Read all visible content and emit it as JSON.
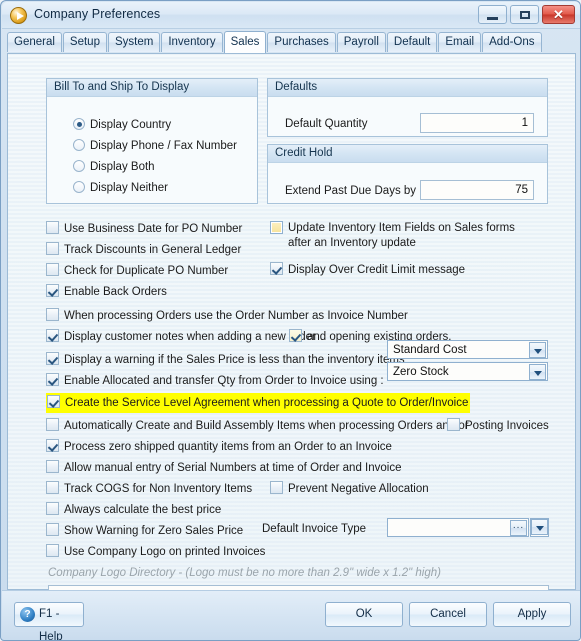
{
  "window": {
    "title": "Company Preferences",
    "icon": "app-logo-icon",
    "minimize_label": "",
    "maximize_label": "",
    "close_label": "✕"
  },
  "tabs": [
    {
      "label": "General",
      "active": false
    },
    {
      "label": "Setup",
      "active": false
    },
    {
      "label": "System",
      "active": false
    },
    {
      "label": "Inventory",
      "active": false
    },
    {
      "label": "Sales",
      "active": true
    },
    {
      "label": "Purchases",
      "active": false
    },
    {
      "label": "Payroll",
      "active": false
    },
    {
      "label": "Default",
      "active": false
    },
    {
      "label": "Email",
      "active": false
    },
    {
      "label": "Add-Ons",
      "active": false
    }
  ],
  "groups": {
    "bill_ship": {
      "header": "Bill To and Ship To Display",
      "options": [
        {
          "label": "Display Country",
          "selected": true
        },
        {
          "label": "Display Phone / Fax Number",
          "selected": false
        },
        {
          "label": "Display Both",
          "selected": false
        },
        {
          "label": "Display Neither",
          "selected": false
        }
      ]
    },
    "defaults": {
      "header": "Defaults",
      "field_label": "Default Quantity",
      "field_value": "1"
    },
    "credit_hold": {
      "header": "Credit Hold",
      "field_label": "Extend Past Due Days by",
      "field_value": "75"
    }
  },
  "checkboxes": {
    "use_business_date": {
      "label": "Use Business Date for PO Number",
      "checked": false
    },
    "track_discounts": {
      "label": "Track Discounts in General Ledger",
      "checked": false
    },
    "check_duplicate_po": {
      "label": "Check for Duplicate PO Number",
      "checked": false
    },
    "enable_back_orders": {
      "label": "Enable Back Orders",
      "checked": true
    },
    "order_number_invoice": {
      "label": "When processing Orders use the Order Number as Invoice Number",
      "checked": false
    },
    "display_customer_notes": {
      "label": "Display customer notes when adding a new order",
      "checked": true
    },
    "opening_existing": {
      "label": "and opening existing orders.",
      "checked": true
    },
    "display_warning_price": {
      "label": "Display a warning if the Sales Price is less than the inventory items",
      "checked": true
    },
    "enable_allocated": {
      "label": "Enable Allocated and transfer Qty from Order to Invoice using :",
      "checked": true
    },
    "create_sla": {
      "label": "Create the Service Level Agreement when processing a Quote to Order/Invoice",
      "checked": true,
      "highlighted": true
    },
    "auto_build_assembly": {
      "label": "Automatically Create and Build Assembly Items when processing Orders and/or",
      "checked": false
    },
    "posting_invoices": {
      "label": "Posting Invoices",
      "checked": false
    },
    "process_zero_shipped": {
      "label": "Process zero shipped quantity items from an Order to an Invoice",
      "checked": true
    },
    "manual_serial": {
      "label": "Allow manual entry of Serial Numbers at time of Order and Invoice",
      "checked": false
    },
    "track_cogs": {
      "label": "Track COGS for Non Inventory Items",
      "checked": false
    },
    "prevent_negative": {
      "label": "Prevent Negative Allocation",
      "checked": false
    },
    "always_best_price": {
      "label": "Always calculate the best price",
      "checked": false
    },
    "zero_sales_warning": {
      "label": "Show Warning for Zero Sales Price",
      "checked": false
    },
    "use_company_logo": {
      "label": "Use Company Logo on printed Invoices",
      "checked": false
    },
    "update_inventory_fields": {
      "label": "Update Inventory Item Fields on Sales forms after an Inventory update",
      "checked": false,
      "focused": true
    },
    "display_over_credit": {
      "label": "Display Over Credit Limit message",
      "checked": true
    }
  },
  "combos": {
    "cost_basis": {
      "value": "Standard Cost"
    },
    "allocation_basis": {
      "value": "Zero Stock"
    },
    "default_invoice_type": {
      "label": "Default Invoice Type",
      "value": ""
    }
  },
  "logo": {
    "hint": "Company Logo Directory - (Logo must be no more than 2.9\" wide x 1.2\" high)",
    "path_value": "",
    "browse_label": "..."
  },
  "footer": {
    "help_label": "F1 - Help",
    "help_glyph": "?",
    "ok_label": "OK",
    "cancel_label": "Cancel",
    "apply_label": "Apply"
  },
  "colors": {
    "highlight": "#ffff00",
    "accent": "#2d5b86",
    "close_button": "#c8372a"
  }
}
